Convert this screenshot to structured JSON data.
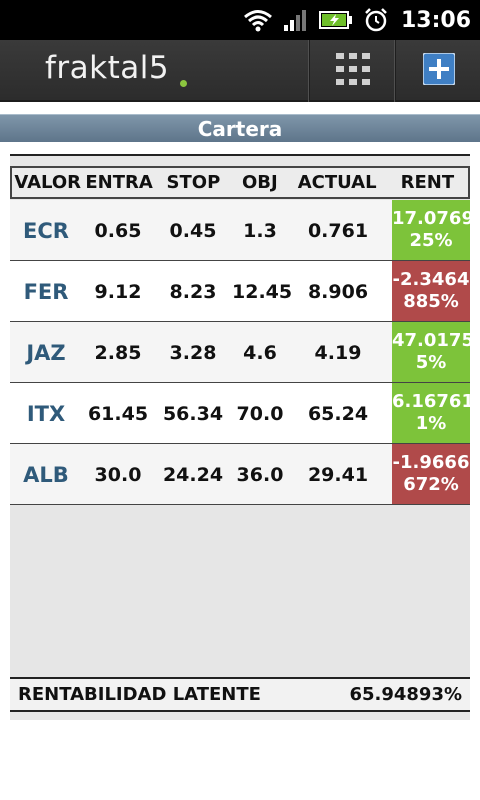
{
  "status_bar": {
    "time": "13:06",
    "icons": [
      "wifi-icon",
      "signal-icon",
      "battery-charging-icon",
      "alarm-icon"
    ]
  },
  "app": {
    "logo": "fraktal5",
    "accent": "#8cc63f",
    "actions": [
      "grid-menu-icon",
      "add-icon"
    ]
  },
  "section": {
    "title": "Cartera"
  },
  "table": {
    "headers": [
      "VALOR",
      "ENTRA",
      "STOP",
      "OBJ",
      "ACTUAL",
      "RENT"
    ],
    "rows": [
      {
        "ticker": "ECR",
        "entra": "0.65",
        "stop": "0.45",
        "obj": "1.3",
        "actual": "0.761",
        "rent_line1": "17.0769",
        "rent_line2": "25%",
        "rent_color": "#7dc33a"
      },
      {
        "ticker": "FER",
        "entra": "9.12",
        "stop": "8.23",
        "obj": "12.45",
        "actual": "8.906",
        "rent_line1": "-2.3464",
        "rent_line2": "885%",
        "rent_color": "#b04a4a"
      },
      {
        "ticker": "JAZ",
        "entra": "2.85",
        "stop": "3.28",
        "obj": "4.6",
        "actual": "4.19",
        "rent_line1": "47.0175",
        "rent_line2": "5%",
        "rent_color": "#7dc33a"
      },
      {
        "ticker": "ITX",
        "entra": "61.45",
        "stop": "56.34",
        "obj": "70.0",
        "actual": "65.24",
        "rent_line1": "6.16761",
        "rent_line2": "1%",
        "rent_color": "#7dc33a"
      },
      {
        "ticker": "ALB",
        "entra": "30.0",
        "stop": "24.24",
        "obj": "36.0",
        "actual": "29.41",
        "rent_line1": "-1.9666",
        "rent_line2": "672%",
        "rent_color": "#b04a4a"
      }
    ]
  },
  "footer": {
    "label": "RENTABILIDAD LATENTE",
    "value": "65.94893%"
  }
}
